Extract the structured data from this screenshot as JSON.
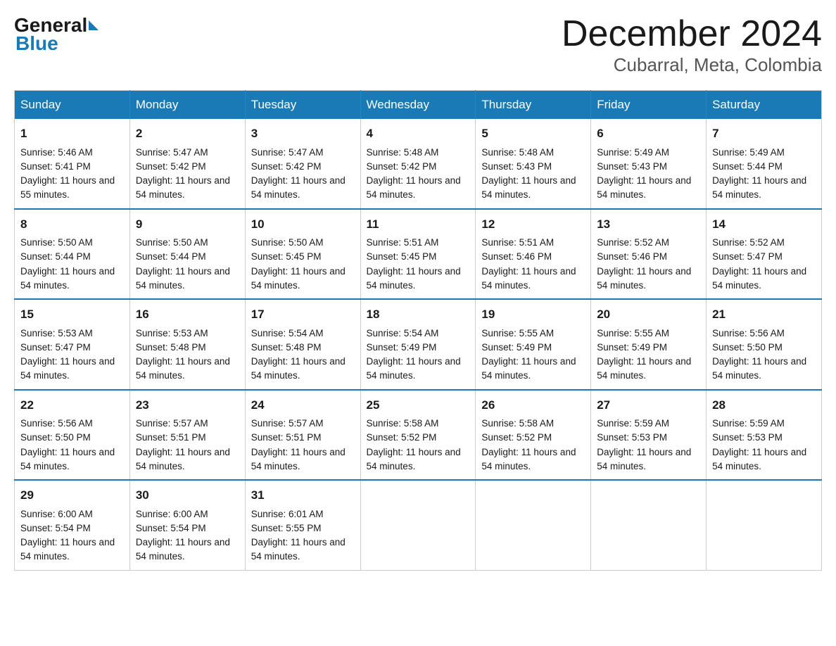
{
  "logo": {
    "general": "General",
    "blue": "Blue"
  },
  "title": {
    "month_year": "December 2024",
    "location": "Cubarral, Meta, Colombia"
  },
  "headers": [
    "Sunday",
    "Monday",
    "Tuesday",
    "Wednesday",
    "Thursday",
    "Friday",
    "Saturday"
  ],
  "weeks": [
    [
      {
        "day": "1",
        "sunrise": "Sunrise: 5:46 AM",
        "sunset": "Sunset: 5:41 PM",
        "daylight": "Daylight: 11 hours and 55 minutes."
      },
      {
        "day": "2",
        "sunrise": "Sunrise: 5:47 AM",
        "sunset": "Sunset: 5:42 PM",
        "daylight": "Daylight: 11 hours and 54 minutes."
      },
      {
        "day": "3",
        "sunrise": "Sunrise: 5:47 AM",
        "sunset": "Sunset: 5:42 PM",
        "daylight": "Daylight: 11 hours and 54 minutes."
      },
      {
        "day": "4",
        "sunrise": "Sunrise: 5:48 AM",
        "sunset": "Sunset: 5:42 PM",
        "daylight": "Daylight: 11 hours and 54 minutes."
      },
      {
        "day": "5",
        "sunrise": "Sunrise: 5:48 AM",
        "sunset": "Sunset: 5:43 PM",
        "daylight": "Daylight: 11 hours and 54 minutes."
      },
      {
        "day": "6",
        "sunrise": "Sunrise: 5:49 AM",
        "sunset": "Sunset: 5:43 PM",
        "daylight": "Daylight: 11 hours and 54 minutes."
      },
      {
        "day": "7",
        "sunrise": "Sunrise: 5:49 AM",
        "sunset": "Sunset: 5:44 PM",
        "daylight": "Daylight: 11 hours and 54 minutes."
      }
    ],
    [
      {
        "day": "8",
        "sunrise": "Sunrise: 5:50 AM",
        "sunset": "Sunset: 5:44 PM",
        "daylight": "Daylight: 11 hours and 54 minutes."
      },
      {
        "day": "9",
        "sunrise": "Sunrise: 5:50 AM",
        "sunset": "Sunset: 5:44 PM",
        "daylight": "Daylight: 11 hours and 54 minutes."
      },
      {
        "day": "10",
        "sunrise": "Sunrise: 5:50 AM",
        "sunset": "Sunset: 5:45 PM",
        "daylight": "Daylight: 11 hours and 54 minutes."
      },
      {
        "day": "11",
        "sunrise": "Sunrise: 5:51 AM",
        "sunset": "Sunset: 5:45 PM",
        "daylight": "Daylight: 11 hours and 54 minutes."
      },
      {
        "day": "12",
        "sunrise": "Sunrise: 5:51 AM",
        "sunset": "Sunset: 5:46 PM",
        "daylight": "Daylight: 11 hours and 54 minutes."
      },
      {
        "day": "13",
        "sunrise": "Sunrise: 5:52 AM",
        "sunset": "Sunset: 5:46 PM",
        "daylight": "Daylight: 11 hours and 54 minutes."
      },
      {
        "day": "14",
        "sunrise": "Sunrise: 5:52 AM",
        "sunset": "Sunset: 5:47 PM",
        "daylight": "Daylight: 11 hours and 54 minutes."
      }
    ],
    [
      {
        "day": "15",
        "sunrise": "Sunrise: 5:53 AM",
        "sunset": "Sunset: 5:47 PM",
        "daylight": "Daylight: 11 hours and 54 minutes."
      },
      {
        "day": "16",
        "sunrise": "Sunrise: 5:53 AM",
        "sunset": "Sunset: 5:48 PM",
        "daylight": "Daylight: 11 hours and 54 minutes."
      },
      {
        "day": "17",
        "sunrise": "Sunrise: 5:54 AM",
        "sunset": "Sunset: 5:48 PM",
        "daylight": "Daylight: 11 hours and 54 minutes."
      },
      {
        "day": "18",
        "sunrise": "Sunrise: 5:54 AM",
        "sunset": "Sunset: 5:49 PM",
        "daylight": "Daylight: 11 hours and 54 minutes."
      },
      {
        "day": "19",
        "sunrise": "Sunrise: 5:55 AM",
        "sunset": "Sunset: 5:49 PM",
        "daylight": "Daylight: 11 hours and 54 minutes."
      },
      {
        "day": "20",
        "sunrise": "Sunrise: 5:55 AM",
        "sunset": "Sunset: 5:49 PM",
        "daylight": "Daylight: 11 hours and 54 minutes."
      },
      {
        "day": "21",
        "sunrise": "Sunrise: 5:56 AM",
        "sunset": "Sunset: 5:50 PM",
        "daylight": "Daylight: 11 hours and 54 minutes."
      }
    ],
    [
      {
        "day": "22",
        "sunrise": "Sunrise: 5:56 AM",
        "sunset": "Sunset: 5:50 PM",
        "daylight": "Daylight: 11 hours and 54 minutes."
      },
      {
        "day": "23",
        "sunrise": "Sunrise: 5:57 AM",
        "sunset": "Sunset: 5:51 PM",
        "daylight": "Daylight: 11 hours and 54 minutes."
      },
      {
        "day": "24",
        "sunrise": "Sunrise: 5:57 AM",
        "sunset": "Sunset: 5:51 PM",
        "daylight": "Daylight: 11 hours and 54 minutes."
      },
      {
        "day": "25",
        "sunrise": "Sunrise: 5:58 AM",
        "sunset": "Sunset: 5:52 PM",
        "daylight": "Daylight: 11 hours and 54 minutes."
      },
      {
        "day": "26",
        "sunrise": "Sunrise: 5:58 AM",
        "sunset": "Sunset: 5:52 PM",
        "daylight": "Daylight: 11 hours and 54 minutes."
      },
      {
        "day": "27",
        "sunrise": "Sunrise: 5:59 AM",
        "sunset": "Sunset: 5:53 PM",
        "daylight": "Daylight: 11 hours and 54 minutes."
      },
      {
        "day": "28",
        "sunrise": "Sunrise: 5:59 AM",
        "sunset": "Sunset: 5:53 PM",
        "daylight": "Daylight: 11 hours and 54 minutes."
      }
    ],
    [
      {
        "day": "29",
        "sunrise": "Sunrise: 6:00 AM",
        "sunset": "Sunset: 5:54 PM",
        "daylight": "Daylight: 11 hours and 54 minutes."
      },
      {
        "day": "30",
        "sunrise": "Sunrise: 6:00 AM",
        "sunset": "Sunset: 5:54 PM",
        "daylight": "Daylight: 11 hours and 54 minutes."
      },
      {
        "day": "31",
        "sunrise": "Sunrise: 6:01 AM",
        "sunset": "Sunset: 5:55 PM",
        "daylight": "Daylight: 11 hours and 54 minutes."
      },
      null,
      null,
      null,
      null
    ]
  ]
}
